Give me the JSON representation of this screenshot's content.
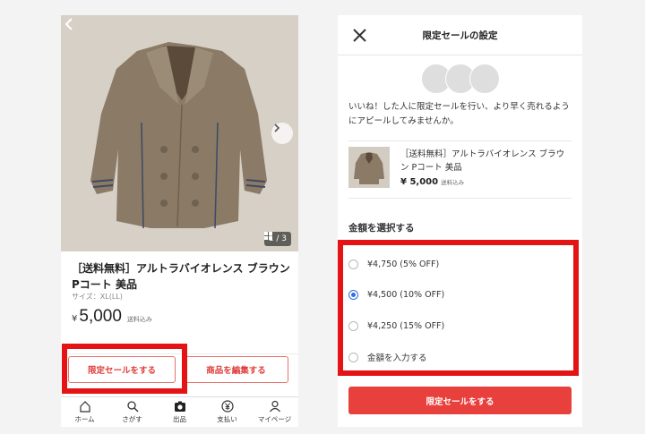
{
  "left": {
    "photo": {
      "back_icon": "chevron-left-icon",
      "next_icon": "chevron-right-icon",
      "page_indicator": "1 / 3"
    },
    "product": {
      "title": "［送料無料］アルトラバイオレンス ブラウン Pコート 美品",
      "size": "サイズ：XL(LL)",
      "currency": "¥",
      "price": "5,000",
      "shipping": "送料込み"
    },
    "actions": {
      "sale_button": "限定セールをする",
      "edit_button": "商品を編集する"
    },
    "tabs": [
      {
        "label": "ホーム",
        "icon": "home-icon"
      },
      {
        "label": "さがす",
        "icon": "search-icon"
      },
      {
        "label": "出品",
        "icon": "camera-icon"
      },
      {
        "label": "支払い",
        "icon": "yen-icon"
      },
      {
        "label": "マイページ",
        "icon": "person-icon"
      }
    ]
  },
  "right": {
    "header": {
      "title": "限定セールの設定",
      "close_icon": "close-icon"
    },
    "promo_text": "いいね！した人に限定セールを行い、より早く売れるようにアピールしてみませんか。",
    "item": {
      "title": "［送料無料］アルトラバイオレンス ブラウン Pコート 美品",
      "price": "¥ 5,000",
      "shipping": "送料込み"
    },
    "choose_label": "金額を選択する",
    "options": [
      {
        "label": "¥4,750 (5% OFF)",
        "selected": false
      },
      {
        "label": "¥4,500 (10% OFF)",
        "selected": true
      },
      {
        "label": "¥4,250 (15% OFF)",
        "selected": false
      },
      {
        "label": "金額を入力する",
        "selected": false
      }
    ],
    "submit_button": "限定セールをする"
  },
  "colors": {
    "accent_red": "#e8403d",
    "highlight_red": "#e41414",
    "radio_blue": "#2f6fe0"
  }
}
